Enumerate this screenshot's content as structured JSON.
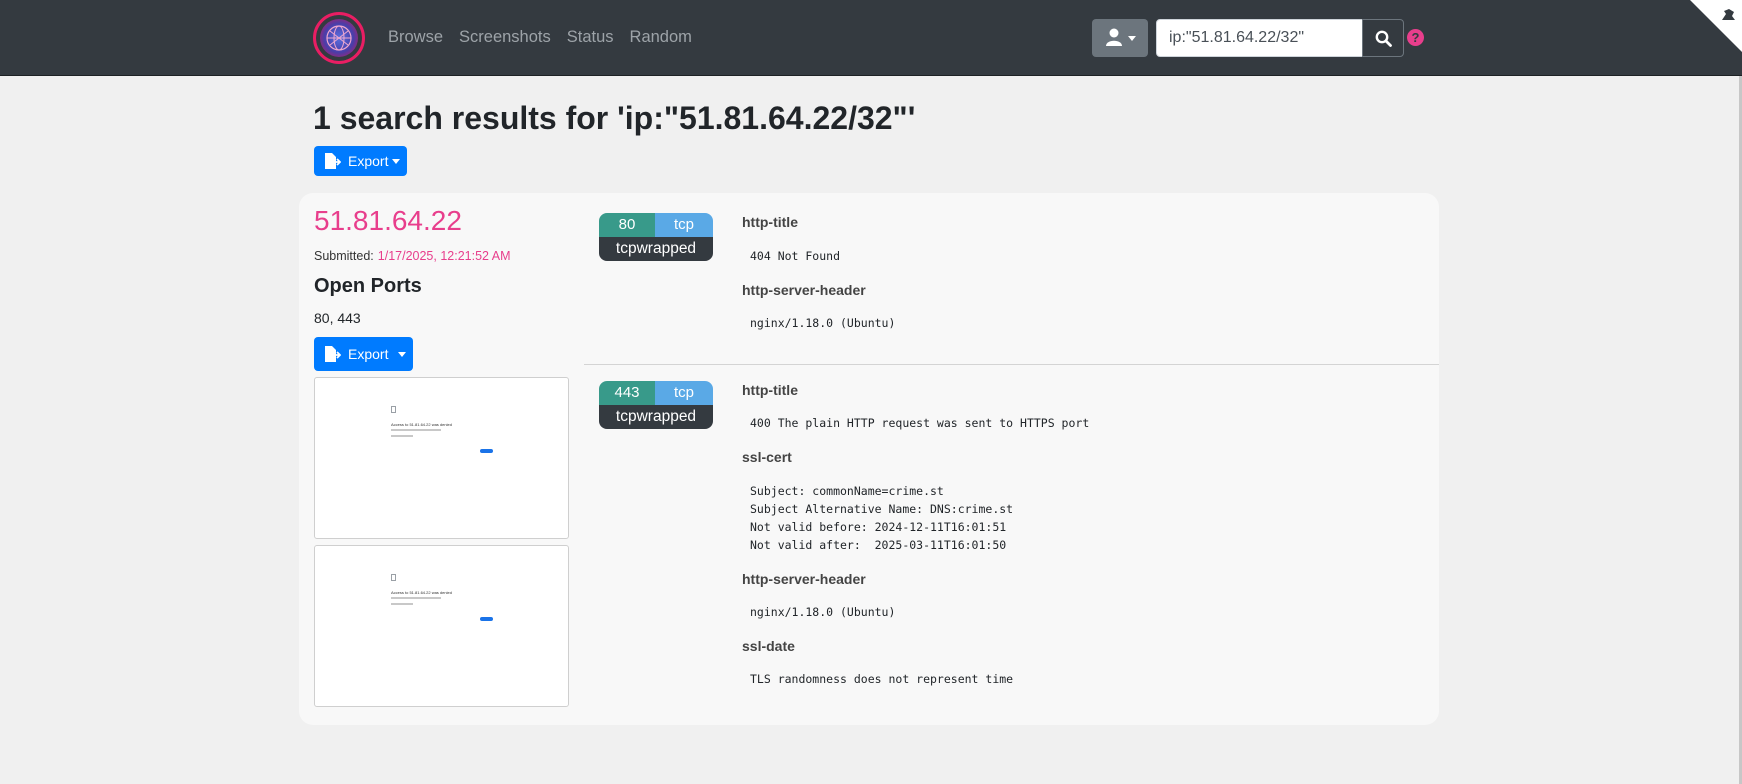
{
  "nav": {
    "links": [
      "Browse",
      "Screenshots",
      "Status",
      "Random"
    ],
    "search_value": "ip:\"51.81.64.22/32\"",
    "help_glyph": "?"
  },
  "page": {
    "title": "1 search results for 'ip:\"51.81.64.22/32\"'",
    "export_label": "Export"
  },
  "host": {
    "ip": "51.81.64.22",
    "submitted_label": "Submitted:",
    "submitted_time": "1/17/2025, 12:21:52 AM",
    "open_ports_title": "Open Ports",
    "open_ports": "80, 443",
    "export_label": "Export",
    "screenshots": [
      {
        "heading": "Access to 51.81.64.22 was denied"
      },
      {
        "heading": "Access to 51.81.64.22 was denied"
      }
    ]
  },
  "ports": [
    {
      "port": "80",
      "protocol": "tcp",
      "service": "tcpwrapped",
      "scripts": [
        {
          "id": "http-title",
          "output": "404 Not Found"
        },
        {
          "id": "http-server-header",
          "output": "nginx/1.18.0 (Ubuntu)"
        }
      ]
    },
    {
      "port": "443",
      "protocol": "tcp",
      "service": "tcpwrapped",
      "scripts": [
        {
          "id": "http-title",
          "output": "400 The plain HTTP request was sent to HTTPS port"
        },
        {
          "id": "ssl-cert",
          "output": "Subject: commonName=crime.st\nSubject Alternative Name: DNS:crime.st\nNot valid before: 2024-12-11T16:01:51\nNot valid after:  2025-03-11T16:01:50"
        },
        {
          "id": "http-server-header",
          "output": "nginx/1.18.0 (Ubuntu)"
        },
        {
          "id": "ssl-date",
          "output": "TLS randomness does not represent time"
        }
      ]
    }
  ],
  "colors": {
    "navbar": "#343a40",
    "accent_pink": "#e83e8c",
    "primary_blue": "#007bff",
    "port_teal": "#389a8a",
    "proto_blue": "#5aa9e6"
  },
  "icons": [
    "globe-logo-icon",
    "user-icon",
    "chevron-down-icon",
    "search-icon",
    "question-circle-icon",
    "file-export-icon",
    "corner-ribbon-icon"
  ]
}
